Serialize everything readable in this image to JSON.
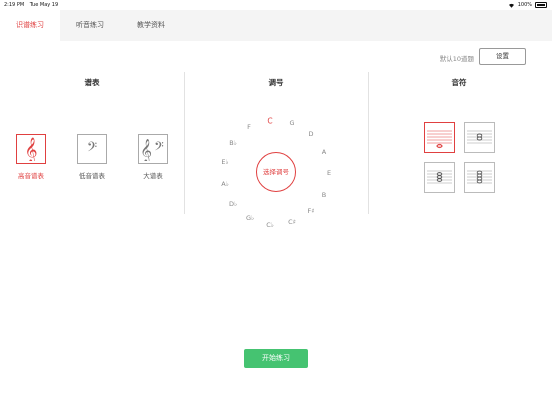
{
  "status_bar": {
    "time": "2:19 PM",
    "date": "Tue May 19",
    "battery": "100%"
  },
  "tabs": [
    {
      "label": "识谱练习",
      "active": true
    },
    {
      "label": "听音练习",
      "active": false
    },
    {
      "label": "教学资料",
      "active": false
    }
  ],
  "toolbar": {
    "default_note": "默认10道题",
    "settings_label": "设置"
  },
  "sections": {
    "staff_title": "谱表",
    "key_title": "调号",
    "note_title": "音符"
  },
  "clefs": [
    {
      "label": "高音谱表",
      "icon": "treble-clef-icon",
      "selected": true
    },
    {
      "label": "低音谱表",
      "icon": "bass-clef-icon",
      "selected": false
    },
    {
      "label": "大谱表",
      "icon": "grand-staff-icon",
      "selected": false
    }
  ],
  "keys": {
    "center_label": "选择调号",
    "items": [
      "C",
      "G",
      "D",
      "A",
      "E",
      "B",
      "F♯",
      "C♯",
      "C♭",
      "G♭",
      "D♭",
      "A♭",
      "E♭",
      "B♭",
      "F"
    ],
    "selected": "C"
  },
  "notes": {
    "selected_index": 0
  },
  "colors": {
    "accent": "#e04040",
    "start_button": "#45c371"
  },
  "start_button_label": "开始练习"
}
